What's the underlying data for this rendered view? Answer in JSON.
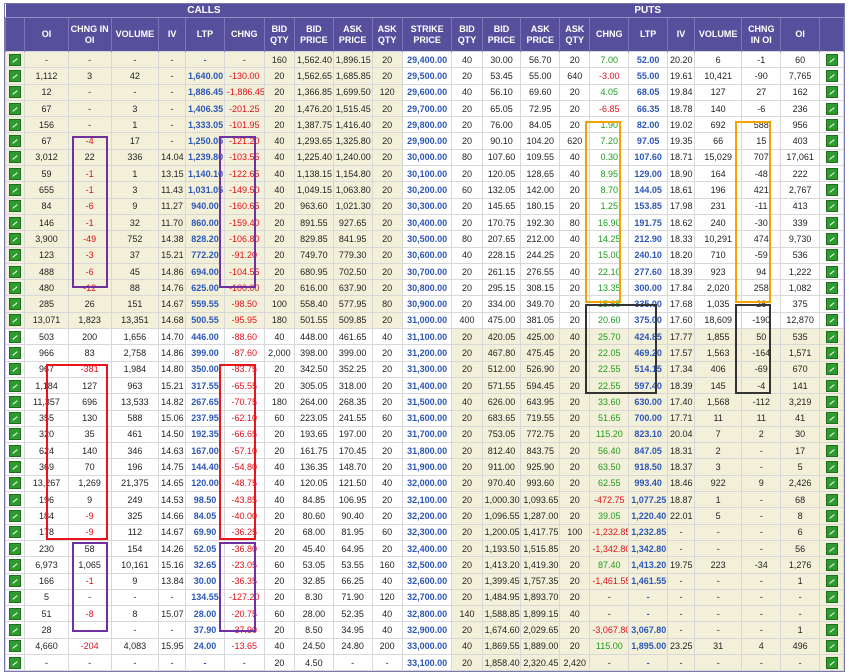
{
  "groups": {
    "calls": "CALLS",
    "puts": "PUTS"
  },
  "headers": [
    "OI",
    "CHNG IN OI",
    "VOLUME",
    "IV",
    "LTP",
    "CHNG",
    "BID QTY",
    "BID PRICE",
    "ASK PRICE",
    "ASK QTY",
    "STRIKE PRICE",
    "BID QTY",
    "BID PRICE",
    "ASK PRICE",
    "ASK QTY",
    "CHNG",
    "LTP",
    "IV",
    "VOLUME",
    "CHNG IN OI",
    "OI"
  ],
  "icon": "chart-icon",
  "colors": {
    "header": "#56509c",
    "itm": "#f3f0da",
    "positive": "#1f9a1f",
    "negative": "#e0101a",
    "link": "#2c57b8",
    "purple_box": "#7030a0",
    "red_box": "#e8131b",
    "orange_box": "#f5a300",
    "black_box": "#333333"
  },
  "rows": [
    {
      "c": [
        "-",
        "-",
        "-",
        "-",
        "-",
        "-",
        "160",
        "1,562.40",
        "1,896.15",
        "20"
      ],
      "s": "29,400.00",
      "p": [
        "40",
        "30.00",
        "56.70",
        "20",
        "7.00",
        "52.00",
        "20.20",
        "6",
        "-1",
        "60"
      ],
      "itm": "call"
    },
    {
      "c": [
        "1,112",
        "3",
        "42",
        "-",
        "1,640.00",
        "-130.00",
        "20",
        "1,562.65",
        "1,685.85",
        "20"
      ],
      "s": "29,500.00",
      "p": [
        "20",
        "53.45",
        "55.00",
        "640",
        "-3.00",
        "55.00",
        "19.61",
        "10,421",
        "-90",
        "7,765"
      ],
      "itm": "call"
    },
    {
      "c": [
        "12",
        "-",
        "-",
        "-",
        "1,886.45",
        "-1,886.45",
        "20",
        "1,366.85",
        "1,699.50",
        "120"
      ],
      "s": "29,600.00",
      "p": [
        "40",
        "56.10",
        "69.60",
        "20",
        "4.05",
        "68.05",
        "19.84",
        "127",
        "27",
        "162"
      ],
      "itm": "call"
    },
    {
      "c": [
        "67",
        "-",
        "3",
        "-",
        "1,406.35",
        "-201.25",
        "20",
        "1,476.20",
        "1,515.45",
        "20"
      ],
      "s": "29,700.00",
      "p": [
        "20",
        "65.05",
        "72.95",
        "20",
        "-6.85",
        "66.35",
        "18.78",
        "140",
        "-6",
        "236"
      ],
      "itm": "call"
    },
    {
      "c": [
        "156",
        "-",
        "1",
        "-",
        "1,333.05",
        "-101.95",
        "20",
        "1,387.75",
        "1,416.40",
        "20"
      ],
      "s": "29,800.00",
      "p": [
        "20",
        "76.00",
        "84.05",
        "20",
        "1.90",
        "82.00",
        "19.02",
        "692",
        "588",
        "956"
      ],
      "itm": "call"
    },
    {
      "c": [
        "67",
        "-4",
        "17",
        "-",
        "1,250.05",
        "-121.20",
        "40",
        "1,293.65",
        "1,325.80",
        "20"
      ],
      "s": "29,900.00",
      "p": [
        "20",
        "90.10",
        "104.20",
        "620",
        "7.20",
        "97.05",
        "19.35",
        "66",
        "15",
        "403"
      ],
      "itm": "call"
    },
    {
      "c": [
        "3,012",
        "22",
        "336",
        "14.04",
        "1,239.80",
        "-103.55",
        "40",
        "1,225.40",
        "1,240.00",
        "20"
      ],
      "s": "30,000.00",
      "p": [
        "80",
        "107.60",
        "109.55",
        "40",
        "0.30",
        "107.60",
        "18.71",
        "15,029",
        "707",
        "17,061"
      ],
      "itm": "call"
    },
    {
      "c": [
        "59",
        "-1",
        "1",
        "13.15",
        "1,140.10",
        "-122.65",
        "40",
        "1,138.15",
        "1,154.80",
        "20"
      ],
      "s": "30,100.00",
      "p": [
        "20",
        "120.05",
        "128.65",
        "40",
        "8.95",
        "129.00",
        "18.90",
        "164",
        "-48",
        "222"
      ],
      "itm": "call"
    },
    {
      "c": [
        "655",
        "-1",
        "3",
        "11.43",
        "1,031.05",
        "-149.50",
        "40",
        "1,049.15",
        "1,063.80",
        "20"
      ],
      "s": "30,200.00",
      "p": [
        "60",
        "132.05",
        "142.00",
        "20",
        "8.70",
        "144.05",
        "18.61",
        "196",
        "421",
        "2,767"
      ],
      "itm": "call"
    },
    {
      "c": [
        "84",
        "-6",
        "9",
        "11.27",
        "940.00",
        "-160.65",
        "20",
        "963.60",
        "1,021.30",
        "20"
      ],
      "s": "30,300.00",
      "p": [
        "20",
        "145.65",
        "180.15",
        "20",
        "1.25",
        "153.85",
        "17.98",
        "231",
        "-11",
        "413"
      ],
      "itm": "call"
    },
    {
      "c": [
        "146",
        "-1",
        "32",
        "11.70",
        "860.00",
        "-159.40",
        "20",
        "891.55",
        "927.65",
        "20"
      ],
      "s": "30,400.00",
      "p": [
        "20",
        "170.75",
        "192.30",
        "80",
        "16.90",
        "191.75",
        "18.62",
        "240",
        "-30",
        "339"
      ],
      "itm": "call"
    },
    {
      "c": [
        "3,900",
        "-49",
        "752",
        "14.38",
        "828.20",
        "-106.80",
        "20",
        "829.85",
        "841.95",
        "20"
      ],
      "s": "30,500.00",
      "p": [
        "80",
        "207.65",
        "212.00",
        "40",
        "14.25",
        "212.90",
        "18.33",
        "10,291",
        "474",
        "9,730"
      ],
      "itm": "call"
    },
    {
      "c": [
        "123",
        "-3",
        "37",
        "15.21",
        "772.20",
        "-91.20",
        "20",
        "749.70",
        "779.30",
        "20"
      ],
      "s": "30,600.00",
      "p": [
        "40",
        "228.15",
        "244.25",
        "20",
        "15.00",
        "240.10",
        "18.20",
        "710",
        "-59",
        "536"
      ],
      "itm": "call"
    },
    {
      "c": [
        "488",
        "-6",
        "45",
        "14.86",
        "694.00",
        "-104.55",
        "20",
        "680.95",
        "702.50",
        "20"
      ],
      "s": "30,700.00",
      "p": [
        "20",
        "261.15",
        "276.55",
        "40",
        "22.10",
        "277.60",
        "18.39",
        "923",
        "94",
        "1,222"
      ],
      "itm": "call"
    },
    {
      "c": [
        "480",
        "-12",
        "88",
        "14.76",
        "625.00",
        "-100.00",
        "20",
        "616.00",
        "637.90",
        "20"
      ],
      "s": "30,800.00",
      "p": [
        "20",
        "295.15",
        "308.15",
        "20",
        "13.35",
        "300.00",
        "17.84",
        "2,020",
        "258",
        "1,082"
      ],
      "itm": "call"
    },
    {
      "c": [
        "285",
        "26",
        "151",
        "14.67",
        "559.55",
        "-98.50",
        "100",
        "558.40",
        "577.95",
        "80"
      ],
      "s": "30,900.00",
      "p": [
        "20",
        "334.00",
        "349.70",
        "20",
        "15.65",
        "335.00",
        "17.68",
        "1,035",
        "26",
        "375"
      ],
      "itm": "call"
    },
    {
      "c": [
        "13,071",
        "1,823",
        "13,351",
        "14.68",
        "500.55",
        "-95.95",
        "180",
        "501.55",
        "509.85",
        "20"
      ],
      "s": "31,000.00",
      "p": [
        "400",
        "475.00",
        "381.05",
        "20",
        "20.60",
        "375.00",
        "17.60",
        "18,609",
        "-190",
        "12,870"
      ],
      "itm": "call"
    },
    {
      "c": [
        "503",
        "200",
        "1,656",
        "14.70",
        "446.00",
        "-88.60",
        "40",
        "448.00",
        "461.65",
        "40"
      ],
      "s": "31,100.00",
      "p": [
        "20",
        "420.05",
        "425.00",
        "40",
        "25.70",
        "424.85",
        "17.77",
        "1,855",
        "50",
        "535"
      ],
      "itm": "put"
    },
    {
      "c": [
        "966",
        "83",
        "2,758",
        "14.86",
        "399.00",
        "-87.60",
        "2,000",
        "398.00",
        "399.00",
        "20"
      ],
      "s": "31,200.00",
      "p": [
        "20",
        "467.80",
        "475.45",
        "20",
        "22.05",
        "469.20",
        "17.57",
        "1,563",
        "-164",
        "1,571"
      ],
      "itm": "put"
    },
    {
      "c": [
        "967",
        "-381",
        "1,984",
        "14.80",
        "350.00",
        "-83.75",
        "20",
        "342.50",
        "352.25",
        "20"
      ],
      "s": "31,300.00",
      "p": [
        "20",
        "512.00",
        "526.90",
        "20",
        "22.55",
        "514.15",
        "17.34",
        "406",
        "-69",
        "670"
      ],
      "itm": "put"
    },
    {
      "c": [
        "1,184",
        "127",
        "963",
        "15.21",
        "317.55",
        "-65.55",
        "20",
        "305.05",
        "318.00",
        "20"
      ],
      "s": "31,400.00",
      "p": [
        "20",
        "571.55",
        "594.45",
        "20",
        "22.55",
        "597.40",
        "18.39",
        "145",
        "-4",
        "141"
      ],
      "itm": "put"
    },
    {
      "c": [
        "11,357",
        "696",
        "13,533",
        "14.82",
        "267.65",
        "-70.75",
        "180",
        "264.00",
        "268.35",
        "20"
      ],
      "s": "31,500.00",
      "p": [
        "40",
        "626.00",
        "643.95",
        "20",
        "33.60",
        "630.00",
        "17.40",
        "1,568",
        "-112",
        "3,219"
      ],
      "itm": "put"
    },
    {
      "c": [
        "355",
        "130",
        "588",
        "15.06",
        "237.95",
        "-62.10",
        "60",
        "223.05",
        "241.55",
        "60"
      ],
      "s": "31,600.00",
      "p": [
        "20",
        "683.65",
        "719.55",
        "20",
        "51.65",
        "700.00",
        "17.71",
        "11",
        "11",
        "41"
      ],
      "itm": "put"
    },
    {
      "c": [
        "320",
        "35",
        "461",
        "14.50",
        "192.35",
        "-66.65",
        "20",
        "193.65",
        "197.00",
        "20"
      ],
      "s": "31,700.00",
      "p": [
        "20",
        "753.05",
        "772.75",
        "20",
        "115.20",
        "823.10",
        "20.04",
        "7",
        "2",
        "30"
      ],
      "itm": "put"
    },
    {
      "c": [
        "624",
        "140",
        "346",
        "14.63",
        "167.00",
        "-57.10",
        "20",
        "161.75",
        "170.45",
        "20"
      ],
      "s": "31,800.00",
      "p": [
        "20",
        "812.40",
        "843.75",
        "20",
        "56.40",
        "847.05",
        "18.31",
        "2",
        "-",
        "17"
      ],
      "itm": "put"
    },
    {
      "c": [
        "369",
        "70",
        "196",
        "14.75",
        "144.40",
        "-54.80",
        "40",
        "136.35",
        "148.70",
        "20"
      ],
      "s": "31,900.00",
      "p": [
        "20",
        "911.00",
        "925.90",
        "20",
        "63.50",
        "918.50",
        "18.37",
        "3",
        "-",
        "5"
      ],
      "itm": "put"
    },
    {
      "c": [
        "13,267",
        "1,269",
        "21,375",
        "14.65",
        "120.00",
        "-48.75",
        "40",
        "120.05",
        "121.50",
        "40"
      ],
      "s": "32,000.00",
      "p": [
        "20",
        "970.40",
        "993.60",
        "20",
        "62.55",
        "993.40",
        "18.46",
        "922",
        "9",
        "2,426"
      ],
      "itm": "put"
    },
    {
      "c": [
        "196",
        "9",
        "249",
        "14.53",
        "98.50",
        "-43.85",
        "40",
        "84.85",
        "106.95",
        "20"
      ],
      "s": "32,100.00",
      "p": [
        "20",
        "1,000.30",
        "1,093.65",
        "20",
        "-472.75",
        "1,077.25",
        "18.87",
        "1",
        "-",
        "68"
      ],
      "itm": "put"
    },
    {
      "c": [
        "184",
        "-9",
        "325",
        "14.66",
        "84.05",
        "-40.00",
        "20",
        "80.60",
        "90.40",
        "20"
      ],
      "s": "32,200.00",
      "p": [
        "20",
        "1,096.55",
        "1,287.00",
        "20",
        "39.05",
        "1,220.40",
        "22.01",
        "5",
        "-",
        "8"
      ],
      "itm": "put"
    },
    {
      "c": [
        "178",
        "-9",
        "112",
        "14.67",
        "69.90",
        "-36.25",
        "20",
        "68.00",
        "81.95",
        "60"
      ],
      "s": "32,300.00",
      "p": [
        "20",
        "1,200.05",
        "1,417.75",
        "100",
        "-1,232.85",
        "1,232.85",
        "-",
        "-",
        "-",
        "6"
      ],
      "itm": "put"
    },
    {
      "c": [
        "230",
        "58",
        "154",
        "14.26",
        "52.05",
        "-36.80",
        "20",
        "45.40",
        "64.95",
        "20"
      ],
      "s": "32,400.00",
      "p": [
        "20",
        "1,193.50",
        "1,515.85",
        "20",
        "-1,342.80",
        "1,342.80",
        "-",
        "-",
        "-",
        "56"
      ],
      "itm": "put"
    },
    {
      "c": [
        "6,973",
        "1,065",
        "10,161",
        "15.16",
        "32.65",
        "-23.05",
        "60",
        "53.05",
        "53.55",
        "160"
      ],
      "s": "32,500.00",
      "p": [
        "20",
        "1,413.20",
        "1,419.30",
        "20",
        "87.40",
        "1,413.20",
        "19.75",
        "223",
        "-34",
        "1,276"
      ],
      "itm": "put"
    },
    {
      "c": [
        "166",
        "-1",
        "9",
        "13.84",
        "30.00",
        "-36.35",
        "20",
        "32.85",
        "66.25",
        "40"
      ],
      "s": "32,600.00",
      "p": [
        "20",
        "1,399.45",
        "1,757.35",
        "20",
        "-1,461.55",
        "1,461.55",
        "-",
        "-",
        "-",
        "1"
      ],
      "itm": "put"
    },
    {
      "c": [
        "5",
        "-",
        "-",
        "-",
        "134.55",
        "-127.20",
        "20",
        "8.30",
        "71.90",
        "120"
      ],
      "s": "32,700.00",
      "p": [
        "20",
        "1,484.95",
        "1,893.70",
        "20",
        "-",
        "-",
        "-",
        "-",
        "-",
        "-"
      ],
      "itm": "put"
    },
    {
      "c": [
        "51",
        "-8",
        "8",
        "15.07",
        "28.00",
        "-20.75",
        "60",
        "28.00",
        "52.35",
        "40"
      ],
      "s": "32,800.00",
      "p": [
        "140",
        "1,588.85",
        "1,899.15",
        "40",
        "-",
        "-",
        "-",
        "-",
        "-",
        "-"
      ],
      "itm": "put"
    },
    {
      "c": [
        "28",
        "-",
        "-",
        "-",
        "37.90",
        "-37.90",
        "20",
        "8.50",
        "34.95",
        "40"
      ],
      "s": "32,900.00",
      "p": [
        "20",
        "1,674.60",
        "2,029.65",
        "20",
        "-3,067.80",
        "3,067.80",
        "-",
        "-",
        "-",
        "1"
      ],
      "itm": "put"
    },
    {
      "c": [
        "4,660",
        "-204",
        "4,083",
        "15.95",
        "24.00",
        "-13.65",
        "40",
        "24.50",
        "24.80",
        "200"
      ],
      "s": "33,000.00",
      "p": [
        "40",
        "1,869.55",
        "1,889.00",
        "20",
        "115.00",
        "1,895.00",
        "23.25",
        "31",
        "4",
        "496"
      ],
      "itm": "put"
    },
    {
      "c": [
        "-",
        "-",
        "-",
        "-",
        "-",
        "-",
        "20",
        "4.50",
        "-",
        "-"
      ],
      "s": "33,100.00",
      "p": [
        "20",
        "1,858.40",
        "2,320.45",
        "2,420",
        "-",
        "-",
        "-",
        "-",
        "-",
        "-"
      ],
      "itm": "put"
    }
  ]
}
